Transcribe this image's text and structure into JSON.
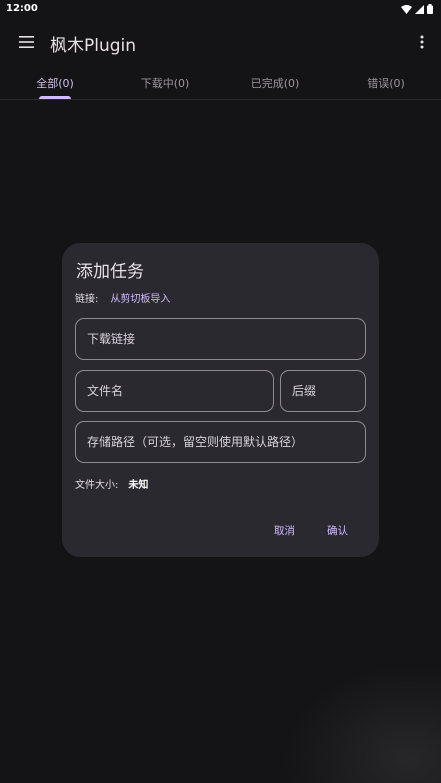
{
  "status_bar": {
    "time": "12:00"
  },
  "app_bar": {
    "title": "枫木Plugin"
  },
  "tabs": [
    {
      "label": "全部(0)",
      "active": true
    },
    {
      "label": "下载中(0)",
      "active": false
    },
    {
      "label": "已完成(0)",
      "active": false
    },
    {
      "label": "错误(0)",
      "active": false
    }
  ],
  "dialog": {
    "title": "添加任务",
    "link_label": "链接:",
    "clipboard_import": "从剪切板导入",
    "url_placeholder": "下载链接",
    "filename_placeholder": "文件名",
    "extension_placeholder": "后缀",
    "path_placeholder": "存储路径（可选，留空则使用默认路径）",
    "file_size_label": "文件大小:",
    "file_size_value": "未知",
    "cancel_label": "取消",
    "confirm_label": "确认"
  },
  "colors": {
    "background": "#141316",
    "dialog_surface": "#2b2930",
    "accent": "#cfbcff",
    "outline": "#8f8a94"
  }
}
